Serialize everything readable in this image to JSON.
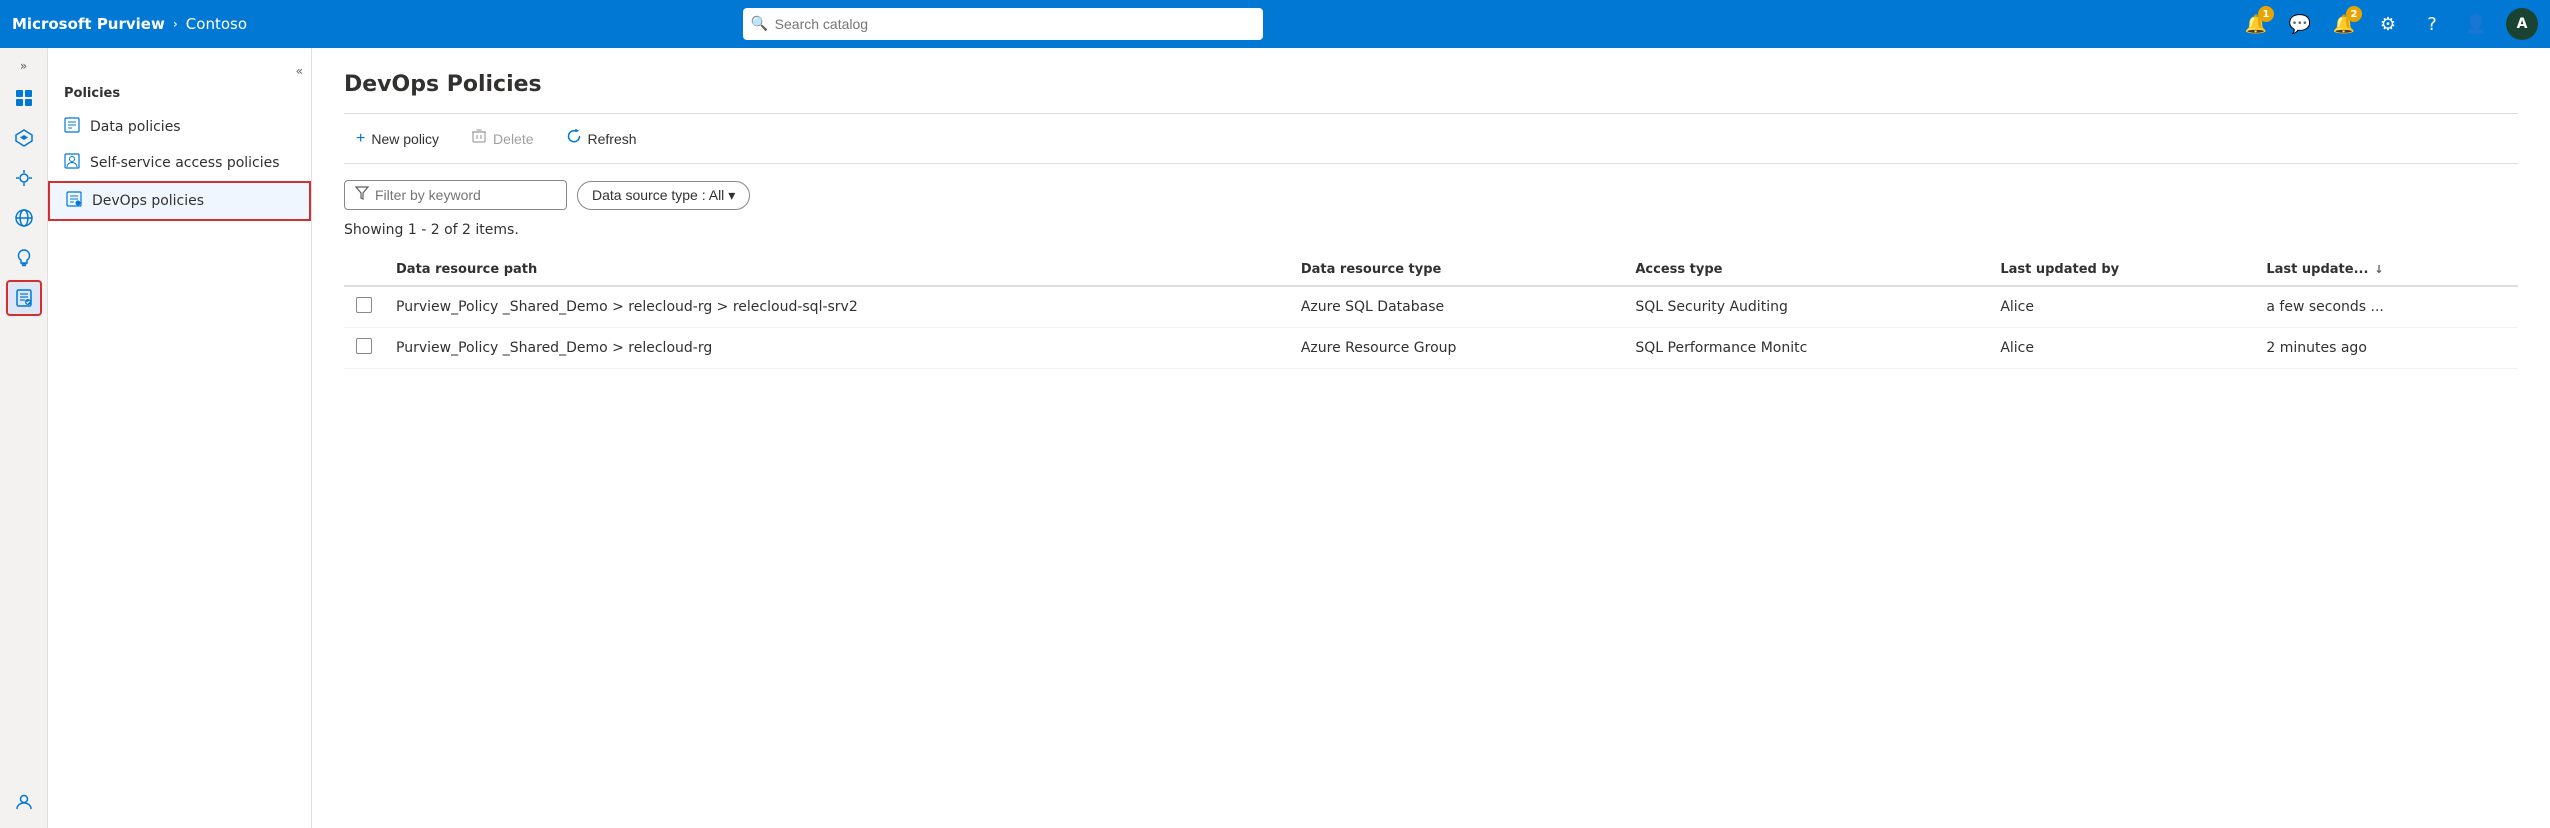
{
  "app": {
    "brand": "Microsoft Purview",
    "tenant": "Contoso",
    "search_placeholder": "Search catalog"
  },
  "topbar": {
    "notifications_badge": "1",
    "alerts_badge": "2",
    "avatar_label": "A"
  },
  "rail": {
    "expand_icon": "»",
    "items": [
      {
        "name": "home",
        "icon": "⊞"
      },
      {
        "name": "catalog",
        "icon": "♦"
      },
      {
        "name": "insights",
        "icon": "◉"
      },
      {
        "name": "data-map",
        "icon": "⊕"
      },
      {
        "name": "lightbulb",
        "icon": "💡"
      },
      {
        "name": "policy",
        "icon": "📋",
        "active": true,
        "highlight": true
      },
      {
        "name": "account",
        "icon": "👤"
      }
    ]
  },
  "sidebar": {
    "section_title": "Policies",
    "items": [
      {
        "label": "Data policies",
        "icon": "data-policies"
      },
      {
        "label": "Self-service access policies",
        "icon": "self-service"
      },
      {
        "label": "DevOps policies",
        "icon": "devops",
        "active": true
      }
    ]
  },
  "content": {
    "page_title": "DevOps Policies",
    "toolbar": {
      "new_policy_label": "New policy",
      "delete_label": "Delete",
      "refresh_label": "Refresh"
    },
    "filter": {
      "filter_placeholder": "Filter by keyword",
      "datasource_label": "Data source type : All"
    },
    "results_text": "Showing 1 - 2 of 2 items.",
    "table": {
      "columns": [
        {
          "key": "path",
          "label": "Data resource path"
        },
        {
          "key": "type",
          "label": "Data resource type"
        },
        {
          "key": "access",
          "label": "Access type"
        },
        {
          "key": "updated_by",
          "label": "Last updated by"
        },
        {
          "key": "updated_at",
          "label": "Last update...",
          "sortable": true
        }
      ],
      "rows": [
        {
          "path": "Purview_Policy _Shared_Demo > relecloud-rg > relecloud-sql-srv2",
          "type": "Azure SQL Database",
          "access": "SQL Security Auditing",
          "updated_by": "Alice",
          "updated_at": "a few seconds ..."
        },
        {
          "path": "Purview_Policy _Shared_Demo > relecloud-rg",
          "type": "Azure Resource Group",
          "access": "SQL Performance Monitc",
          "updated_by": "Alice",
          "updated_at": "2 minutes ago"
        }
      ]
    }
  }
}
